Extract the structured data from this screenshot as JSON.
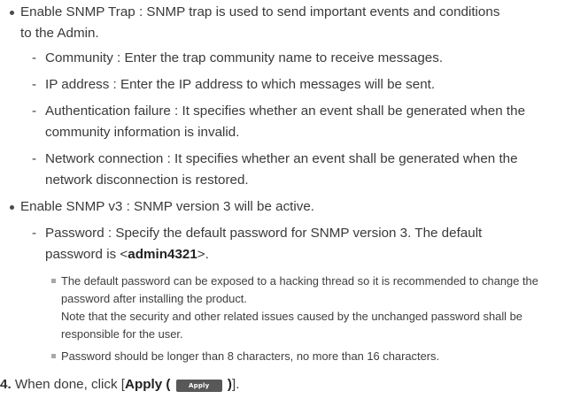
{
  "trap": {
    "line1": "Enable SNMP Trap : SNMP trap is used to send important events and conditions",
    "line2": "to the Admin.",
    "community": "Community : Enter the trap community name to receive messages.",
    "ip": "IP address : Enter the IP address to which messages will be sent.",
    "auth1": "Authentication failure : It specifies whether an event shall be generated when the",
    "auth2": "community information is invalid.",
    "net1": "Network connection : It specifies whether an event shall be generated when the",
    "net2": "network disconnection is restored."
  },
  "v3": {
    "line": "Enable SNMP v3 : SNMP version 3 will be active.",
    "pw1": "Password : Specify the default password for SNMP version 3. The default",
    "pw2_prefix": "password is <",
    "pw2_bold": "admin4321",
    "pw2_suffix": ">."
  },
  "notes": {
    "n1a": "The default password can be exposed to a hacking thread so it is recommended to change the",
    "n1b": "password after installing the product.",
    "n1c": "Note that the security and other related issues caused by the unchanged password shall be",
    "n1d": "responsible for the user.",
    "n2": "Password should be longer than 8 characters, no more than 16 characters."
  },
  "step4": {
    "number": "4.",
    "text": "When done, click [",
    "bold_label": "Apply (",
    "button_label": "Apply",
    "close_paren": " )",
    "end": "]."
  }
}
